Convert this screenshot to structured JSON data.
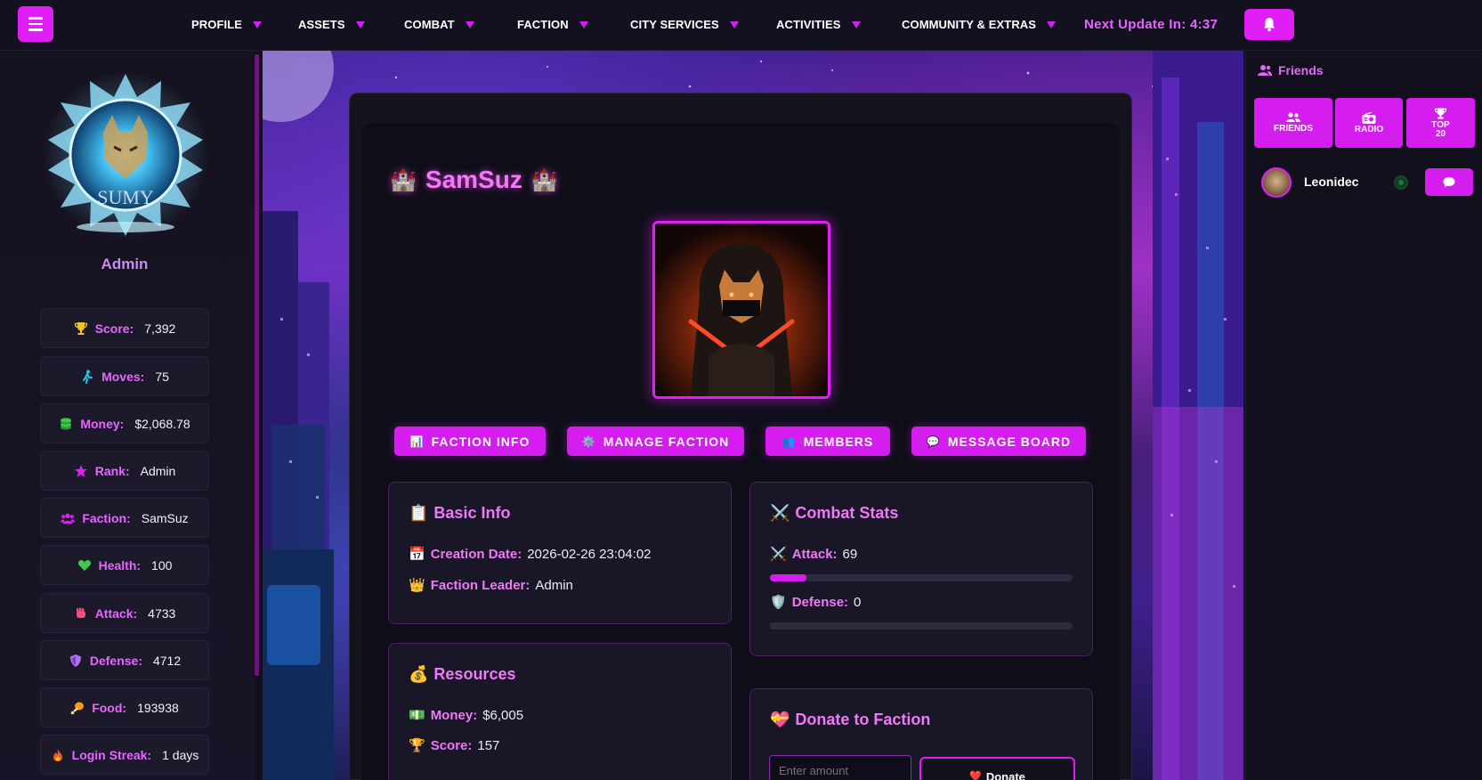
{
  "nav": {
    "menu_icon": "hamburger-icon",
    "items": [
      {
        "label": "PROFILE"
      },
      {
        "label": "ASSETS"
      },
      {
        "label": "COMBAT"
      },
      {
        "label": "FACTION"
      },
      {
        "label": "CITY SERVICES"
      },
      {
        "label": "ACTIVITIES"
      },
      {
        "label": "COMMUNITY & EXTRAS"
      }
    ],
    "update_timer": "Next Update In: 4:37",
    "bell_icon": "bell-icon"
  },
  "sidebar": {
    "role": "Admin",
    "emblem_text": "SUMY",
    "stats": [
      {
        "label": "Score:",
        "value": "7,392",
        "icon": "trophy-icon",
        "color": "#f5c31c"
      },
      {
        "label": "Moves:",
        "value": "75",
        "icon": "walking-icon",
        "color": "#24c6e8"
      },
      {
        "label": "Money:",
        "value": "$2,068.78",
        "icon": "money-icon",
        "color": "#3ec94a"
      },
      {
        "label": "Rank:",
        "value": "Admin",
        "icon": "star-icon",
        "color": "#e01ef5"
      },
      {
        "label": "Faction:",
        "value": "SamSuz",
        "icon": "users-icon",
        "color": "#e01ef5"
      },
      {
        "label": "Health:",
        "value": "100",
        "icon": "heart-icon",
        "color": "#3ec94a"
      },
      {
        "label": "Attack:",
        "value": "4733",
        "icon": "fist-icon",
        "color": "#f0507a"
      },
      {
        "label": "Defense:",
        "value": "4712",
        "icon": "shield-icon",
        "color": "#b070f0"
      },
      {
        "label": "Food:",
        "value": "193938",
        "icon": "drumstick-icon",
        "color": "#f59a1c"
      },
      {
        "label": "Login Streak:",
        "value": "1 days",
        "icon": "fire-icon",
        "color": "#f05a1c"
      }
    ]
  },
  "faction": {
    "name": "SamSuz",
    "tabs": [
      {
        "label": "FACTION INFO",
        "icon": "chart-icon"
      },
      {
        "label": "MANAGE FACTION",
        "icon": "gear-icon"
      },
      {
        "label": "MEMBERS",
        "icon": "members-icon"
      },
      {
        "label": "MESSAGE BOARD",
        "icon": "message-icon"
      }
    ],
    "basic_info": {
      "title": "Basic Info",
      "creation_label": "Creation Date:",
      "creation_value": "2026-02-26 23:04:02",
      "leader_label": "Faction Leader:",
      "leader_value": "Admin"
    },
    "combat_stats": {
      "title": "Combat Stats",
      "attack_label": "Attack:",
      "attack_value": "69",
      "attack_fill": 0.12,
      "defense_label": "Defense:",
      "defense_value": "0",
      "defense_fill": 0
    },
    "resources": {
      "title": "Resources",
      "money_label": "Money:",
      "money_value": "$6,005",
      "score_label": "Score:",
      "score_value": "157"
    },
    "donate": {
      "title": "Donate to Faction",
      "placeholder": "Enter amount",
      "button_label": "Donate"
    }
  },
  "right_panel": {
    "header": "Friends",
    "buttons": [
      {
        "label": "FRIENDS",
        "icon": "users-icon"
      },
      {
        "label": "RADIO",
        "icon": "radio-icon"
      },
      {
        "label": "TOP 20",
        "icon": "trophy-icon"
      }
    ],
    "friends": [
      {
        "name": "Leonidec",
        "status": "online",
        "chat_icon": "chat-icon"
      }
    ]
  },
  "colors": {
    "accent": "#e01ef5",
    "accent_text": "#f07af5",
    "panel": "#191628",
    "background": "#12101f"
  }
}
